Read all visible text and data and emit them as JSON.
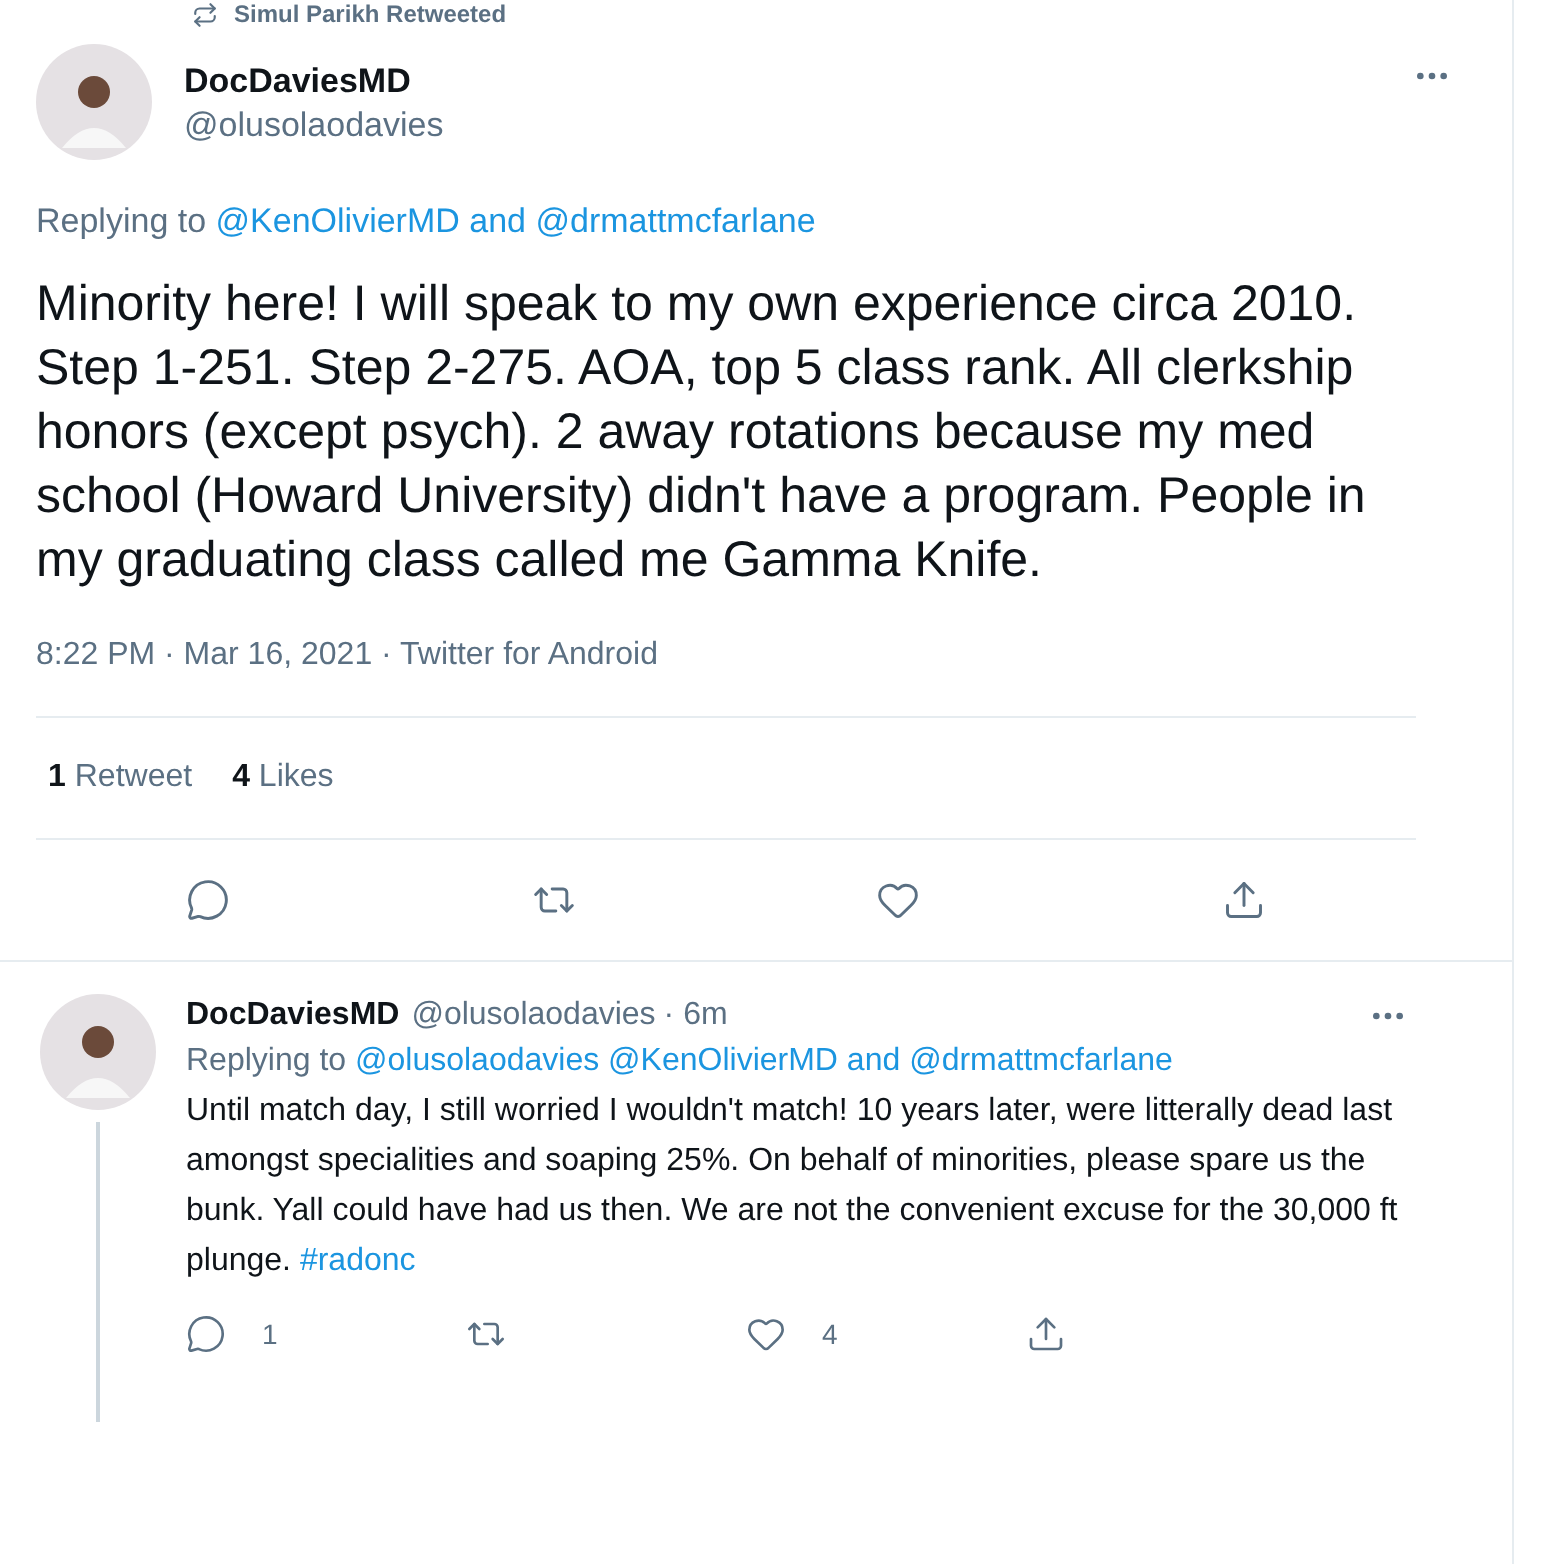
{
  "retweet_banner": {
    "text": "Simul Parikh Retweeted"
  },
  "main_tweet": {
    "name": "DocDaviesMD",
    "handle": "@olusolaodavies",
    "replying": {
      "label": "Replying to",
      "mentions": [
        "@KenOlivierMD",
        "@drmattmcfarlane"
      ],
      "conjunction": "and"
    },
    "text": "Minority here! I will speak to my own experience circa 2010. Step 1-251. Step 2-275. AOA, top 5 class rank. All clerkship honors (except psych). 2 away rotations because my med school (Howard University) didn't have a program. People in my graduating class called me Gamma Knife.",
    "meta": "8:22 PM · Mar 16, 2021 · Twitter for Android",
    "stats": [
      {
        "count": "1",
        "label": "Retweet"
      },
      {
        "count": "4",
        "label": "Likes"
      }
    ],
    "actions": [
      {
        "kind": "reply"
      },
      {
        "kind": "retweet"
      },
      {
        "kind": "like"
      },
      {
        "kind": "share"
      }
    ]
  },
  "reply_tweet": {
    "name": "DocDaviesMD",
    "handle": "@olusolaodavies",
    "time": "· 6m",
    "replying": {
      "label": "Replying to",
      "mentions": [
        "@olusolaodavies",
        "@KenOlivierMD",
        "@drmattmcfarlane"
      ],
      "conjunction": "and"
    },
    "body": [
      {
        "kind": "plain",
        "text": "Until match day, I still worried I wouldn't match! 10 years later, were litterally dead last amongst specialities and soaping 25%. On behalf of minorities, please spare us the bunk. Yall could have had us then. We are not the convenient excuse for the 30,000 ft plunge."
      },
      {
        "kind": "link",
        "text": "#radonc"
      }
    ],
    "actions": [
      {
        "kind": "reply",
        "count": "1"
      },
      {
        "kind": "retweet"
      },
      {
        "kind": "like",
        "count": "4"
      },
      {
        "kind": "share"
      }
    ]
  }
}
